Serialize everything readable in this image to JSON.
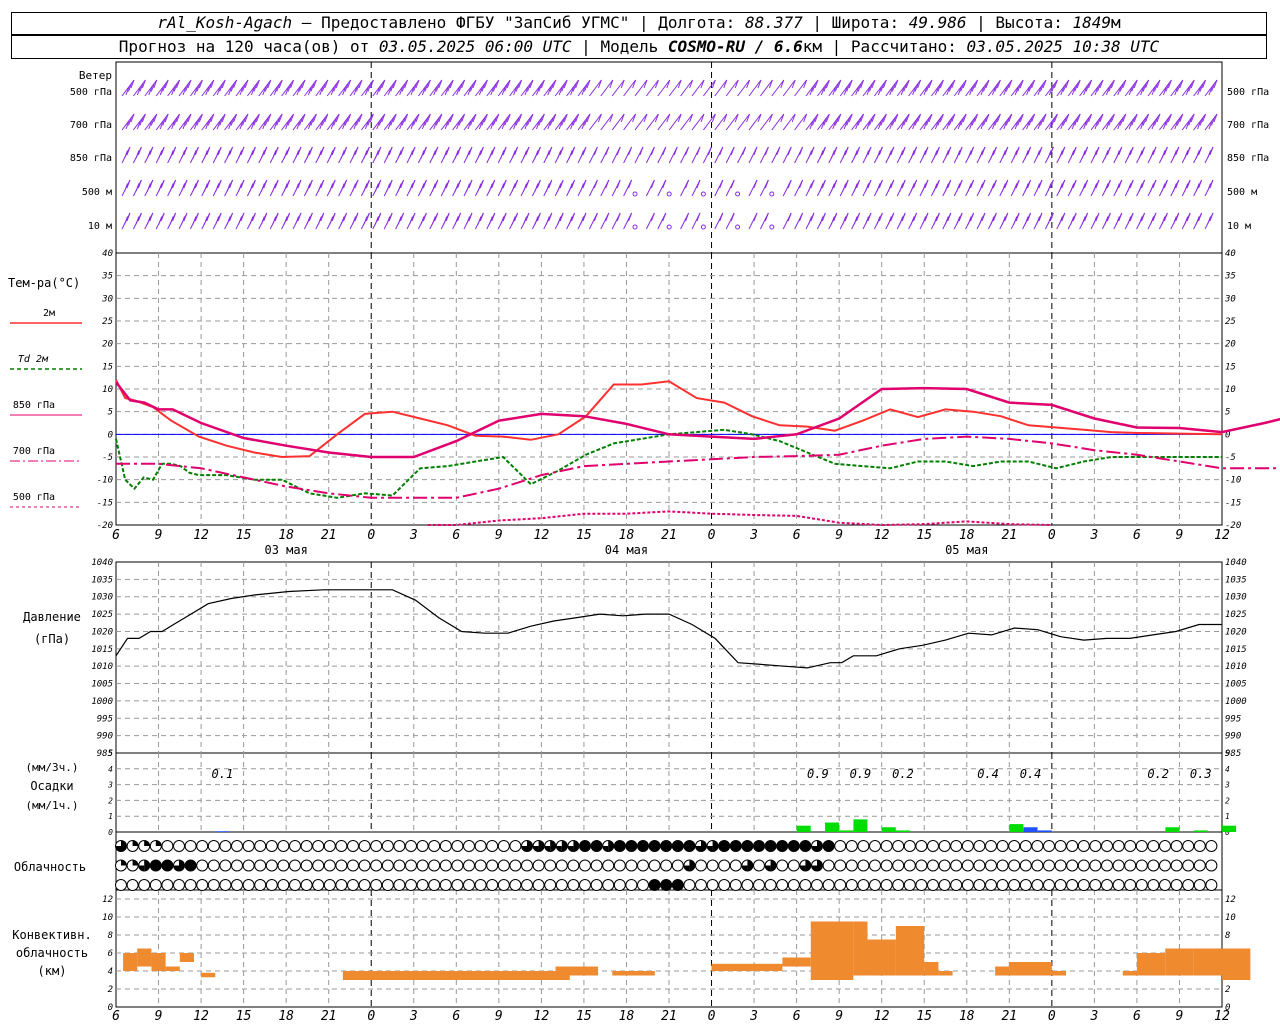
{
  "header": {
    "station": "rAl_Kosh-Agach",
    "provider": "Предоставлено ФГБУ \"ЗапСиб УГМС\"",
    "lon_label": "Долгота:",
    "lon": "88.377",
    "lat_label": "Широта:",
    "lat": "49.986",
    "alt_label": "Высота:",
    "alt": "1849",
    "alt_unit": "м",
    "forecast_prefix": "Прогноз на 120 часа(ов) от",
    "forecast_time": "03.05.2025 06:00 UTC",
    "model_label": "Модель",
    "model": "COSMO-RU / 6.6",
    "model_unit": "км",
    "calc_label": "Рассчитано:",
    "calc_time": "03.05.2025 10:38 UTC"
  },
  "labels": {
    "wind_title": "Ветер",
    "wind_levels": [
      "500 гПа",
      "700 гПа",
      "850 гПа",
      "500 м",
      "10  м"
    ],
    "temp_title": "Тем-ра(°С)",
    "temp_legend": [
      "2м",
      "Td  2м",
      "850 гПа",
      "700 гПа",
      "500 гПа"
    ],
    "pressure_title": "Давление",
    "pressure_unit": "(гПа)",
    "precip_unit_3h": "(мм/3ч.)",
    "precip_title": "Осадки",
    "precip_unit_1h": "(мм/1ч.)",
    "cloud_title": "Облачность",
    "conv_title": [
      "Конвективн.",
      "облачность",
      "(км)"
    ]
  },
  "colors": {
    "t2m": "#ff3030",
    "td2m": "#008000",
    "t850": "#e0006e",
    "t700": "#e0006e",
    "t500": "#e0006e",
    "wind": "#8a2be2",
    "zero_line": "#0000ff",
    "precip_main": "#00dd00",
    "precip_alt": "#2050ff",
    "conv": "#ef8a2f"
  },
  "chart_data": [
    {
      "type": "line",
      "name": "temperature",
      "x_ticks": [
        "6",
        "9",
        "12",
        "15",
        "18",
        "21",
        "0",
        "3",
        "6",
        "9",
        "12",
        "15",
        "18",
        "21",
        "0",
        "3",
        "6",
        "9",
        "12",
        "15",
        "18",
        "21",
        "0",
        "3",
        "6",
        "9",
        "12"
      ],
      "day_labels": [
        {
          "hour": 12,
          "text": "03 мая"
        },
        {
          "hour": 36,
          "text": "04 мая"
        },
        {
          "hour": 60,
          "text": "05 мая"
        }
      ],
      "ylim": [
        -20,
        40
      ],
      "yticks": [
        -20,
        -15,
        -10,
        -5,
        0,
        5,
        10,
        15,
        20,
        25,
        30,
        35,
        40
      ],
      "series": [
        {
          "name": "2м",
          "x": [
            0,
            1,
            2,
            4,
            6,
            9,
            12,
            15,
            18,
            21,
            24,
            27,
            30,
            33,
            36,
            39,
            42,
            45,
            48,
            51,
            54,
            57,
            60,
            63,
            66,
            69,
            72,
            75,
            78,
            81,
            84,
            87,
            90,
            93,
            96,
            99,
            102,
            105,
            108,
            111,
            114,
            117,
            120
          ],
          "y": [
            12,
            8,
            7.5,
            6,
            3,
            -0.5,
            -2.5,
            -4,
            -5,
            -4.8,
            0,
            4.5,
            5,
            3.5,
            2,
            -0.3,
            -0.5,
            -1.2,
            0,
            4,
            11,
            11,
            11.7,
            8,
            7,
            4,
            2,
            1.7,
            0.8,
            3,
            5.5,
            3.8,
            5.5,
            5,
            4,
            2,
            1.5,
            1,
            0.5,
            0.3,
            0.2,
            0.1,
            0
          ]
        },
        {
          "name": "Td  2м",
          "x": [
            0,
            1,
            2,
            3,
            4,
            5,
            6,
            7,
            8,
            9,
            12,
            15,
            18,
            21,
            24,
            27,
            30,
            33,
            36,
            39,
            42,
            45,
            48,
            51,
            54,
            57,
            60,
            63,
            66,
            69,
            72,
            75,
            78,
            81,
            84,
            87,
            90,
            93,
            96,
            99,
            102,
            105,
            108,
            111,
            114,
            117,
            120
          ],
          "y": [
            -1,
            -10,
            -12,
            -9.5,
            -10,
            -6.5,
            -6.5,
            -7,
            -8.5,
            -9,
            -9,
            -10,
            -10,
            -13,
            -14,
            -13,
            -13.5,
            -7.5,
            -7,
            -6,
            -5,
            -11,
            -8,
            -4.5,
            -2,
            -1,
            0,
            0.5,
            1,
            0,
            -1.5,
            -4,
            -6.5,
            -7,
            -7.5,
            -6,
            -6,
            -7,
            -6,
            -6,
            -7.5,
            -6,
            -5,
            -5,
            -5,
            -5,
            -5
          ]
        },
        {
          "name": "850 гПа",
          "x": [
            0,
            1,
            2,
            3,
            4,
            6,
            9,
            12,
            15,
            18,
            21,
            24,
            27,
            30,
            33,
            36,
            39,
            42,
            45,
            48,
            51,
            54,
            57,
            60,
            63,
            66,
            69,
            72,
            75,
            78,
            81,
            84,
            87,
            90,
            93,
            96
          ],
          "y": [
            11.5,
            7.5,
            7,
            5.5,
            5.5,
            2.5,
            -0.8,
            -2.5,
            -4,
            -5,
            -5,
            -1.5,
            3,
            4.5,
            4,
            2.3,
            0,
            -0.5,
            -1,
            0,
            3.5,
            10,
            10.2,
            10,
            7,
            6.5,
            3.5,
            1.5,
            1.4,
            0.5,
            2.5,
            4.8,
            3.3,
            4.6,
            4.2,
            2.5
          ]
        },
        {
          "name": "700 гПа",
          "x": [
            0,
            3,
            6,
            9,
            12,
            15,
            18,
            21,
            24,
            27,
            30,
            33,
            36,
            39,
            42,
            45,
            48,
            51,
            54,
            57,
            60,
            63,
            66,
            69,
            72,
            75,
            78,
            81,
            84,
            87,
            90,
            93,
            96
          ],
          "y": [
            -6.5,
            -6.5,
            -7.5,
            -9.5,
            -11.5,
            -13,
            -14,
            -14,
            -14,
            -12,
            -9,
            -7,
            -6.5,
            -6,
            -5.5,
            -5,
            -4.8,
            -4.5,
            -2.5,
            -1,
            -0.5,
            -1,
            -2,
            -3.5,
            -4.5,
            -6,
            -7.5,
            -7.5,
            -7.5,
            -7,
            -7,
            -8,
            -8.5
          ]
        },
        {
          "name": "500 гПа",
          "x": [
            22,
            24,
            27,
            30,
            33,
            36,
            39,
            42,
            45,
            48,
            51,
            54,
            57,
            60,
            63,
            66
          ],
          "y": [
            -20.5,
            -20,
            -19,
            -18.5,
            -17.5,
            -17.5,
            -17,
            -17.5,
            -17.8,
            -18,
            -19.5,
            -20,
            -19.8,
            -19.2,
            -19.8,
            -20
          ]
        }
      ]
    },
    {
      "type": "line",
      "name": "pressure",
      "ylim": [
        985,
        1040
      ],
      "yticks": [
        985,
        990,
        995,
        1000,
        1005,
        1010,
        1015,
        1020,
        1025,
        1030,
        1035,
        1040
      ],
      "series": [
        {
          "name": "Давление",
          "x": [
            0,
            1,
            2,
            3,
            4,
            5,
            6,
            8,
            10,
            12,
            15,
            18,
            21,
            24,
            26,
            28,
            30,
            32,
            34,
            36,
            38,
            40,
            42,
            44,
            46,
            48,
            50,
            52,
            54,
            56,
            58,
            60,
            62,
            63,
            64,
            66,
            68,
            70,
            72,
            74,
            76,
            78,
            80,
            82,
            84,
            86,
            88,
            90,
            92,
            94,
            96
          ],
          "y": [
            1013,
            1018,
            1018,
            1020,
            1020,
            1022,
            1024,
            1028,
            1029.5,
            1030.5,
            1031.5,
            1032,
            1032,
            1032,
            1029,
            1024,
            1020,
            1019.5,
            1019.5,
            1021.5,
            1023,
            1024,
            1025,
            1024.5,
            1025,
            1025,
            1022,
            1018,
            1011,
            1010.5,
            1010,
            1009.5,
            1011,
            1011,
            1013,
            1013,
            1015,
            1016,
            1017.5,
            1019.5,
            1019,
            1021,
            1020.5,
            1018.5,
            1017.5,
            1018,
            1018,
            1019,
            1020,
            1022,
            1022
          ]
        }
      ]
    },
    {
      "type": "bar",
      "name": "precipitation",
      "ylim": [
        0,
        5
      ],
      "yticks": [
        0,
        1,
        2,
        3,
        4,
        5
      ],
      "totals_3h": [
        {
          "hour": 7.5,
          "text": "0.1"
        },
        {
          "hour": 49.5,
          "text": "0.9"
        },
        {
          "hour": 52.5,
          "text": "0.9"
        },
        {
          "hour": 55.5,
          "text": "0.2"
        },
        {
          "hour": 61.5,
          "text": "0.4"
        },
        {
          "hour": 64.5,
          "text": "0.4"
        },
        {
          "hour": 73.5,
          "text": "0.2"
        },
        {
          "hour": 76.5,
          "text": "0.3"
        }
      ],
      "bars_1h": [
        {
          "hour": 48.5,
          "value": 0.4,
          "kind": "main"
        },
        {
          "hour": 50.5,
          "value": 0.6,
          "kind": "main"
        },
        {
          "hour": 51.5,
          "value": 0.1,
          "kind": "main"
        },
        {
          "hour": 52.5,
          "value": 0.8,
          "kind": "main"
        },
        {
          "hour": 54.5,
          "value": 0.3,
          "kind": "main"
        },
        {
          "hour": 55.5,
          "value": 0.1,
          "kind": "main"
        },
        {
          "hour": 63.5,
          "value": 0.5,
          "kind": "main"
        },
        {
          "hour": 64.5,
          "value": 0.3,
          "kind": "alt"
        },
        {
          "hour": 65.5,
          "value": 0.1,
          "kind": "alt"
        },
        {
          "hour": 74.5,
          "value": 0.3,
          "kind": "main"
        },
        {
          "hour": 76.5,
          "value": 0.1,
          "kind": "main"
        },
        {
          "hour": 78.5,
          "value": 0.4,
          "kind": "main"
        },
        {
          "hour": 7.5,
          "value": 0.05,
          "kind": "alt"
        }
      ]
    },
    {
      "type": "table",
      "name": "cloud_cover",
      "rows": [
        "31110000000000000000000000000000000333334434444444334444444434000000000000000000000000000000000",
        "11344340000000000000000000000000000000000000000003000030300330000000000000000000000000000000000",
        "00000000000000000000000000000000000000000000004440000000000000000000000000000000000000000000000"
      ]
    },
    {
      "type": "bar",
      "name": "convective_cloud",
      "ylim": [
        0,
        13
      ],
      "yticks": [
        0,
        2,
        4,
        6,
        8,
        10,
        12
      ],
      "segments": [
        {
          "x0": 0.5,
          "x1": 1.5,
          "bottom": 4,
          "top": 6
        },
        {
          "x0": 1.5,
          "x1": 2.5,
          "bottom": 4.5,
          "top": 6.5
        },
        {
          "x0": 2.5,
          "x1": 3.5,
          "bottom": 4,
          "top": 6
        },
        {
          "x0": 3.5,
          "x1": 4.5,
          "bottom": 4,
          "top": 4.5
        },
        {
          "x0": 4.5,
          "x1": 5.5,
          "bottom": 5,
          "top": 6
        },
        {
          "x0": 6,
          "x1": 7,
          "bottom": 3.3,
          "top": 3.8
        },
        {
          "x0": 16,
          "x1": 32,
          "bottom": 3,
          "top": 4
        },
        {
          "x0": 31,
          "x1": 34,
          "bottom": 3.5,
          "top": 4.5
        },
        {
          "x0": 35,
          "x1": 38,
          "bottom": 3.5,
          "top": 4
        },
        {
          "x0": 42,
          "x1": 47,
          "bottom": 4,
          "top": 4.8
        },
        {
          "x0": 47,
          "x1": 49,
          "bottom": 4.5,
          "top": 5.5
        },
        {
          "x0": 49,
          "x1": 52,
          "bottom": 3,
          "top": 9.5
        },
        {
          "x0": 52,
          "x1": 53,
          "bottom": 3.5,
          "top": 9.5
        },
        {
          "x0": 53,
          "x1": 55,
          "bottom": 3.5,
          "top": 7.5
        },
        {
          "x0": 55,
          "x1": 57,
          "bottom": 3.5,
          "top": 9
        },
        {
          "x0": 57,
          "x1": 58,
          "bottom": 3.5,
          "top": 5
        },
        {
          "x0": 58,
          "x1": 59,
          "bottom": 3.5,
          "top": 4
        },
        {
          "x0": 62,
          "x1": 63,
          "bottom": 3.5,
          "top": 4.5
        },
        {
          "x0": 63,
          "x1": 66,
          "bottom": 3.5,
          "top": 5
        },
        {
          "x0": 65,
          "x1": 67,
          "bottom": 3.5,
          "top": 4
        },
        {
          "x0": 71,
          "x1": 72,
          "bottom": 3.5,
          "top": 4
        },
        {
          "x0": 72,
          "x1": 74,
          "bottom": 3.5,
          "top": 6
        },
        {
          "x0": 74,
          "x1": 76,
          "bottom": 3.5,
          "top": 6.5
        },
        {
          "x0": 76,
          "x1": 78,
          "bottom": 3.5,
          "top": 6.5
        },
        {
          "x0": 78,
          "x1": 80,
          "bottom": 3,
          "top": 6.5
        }
      ]
    }
  ]
}
